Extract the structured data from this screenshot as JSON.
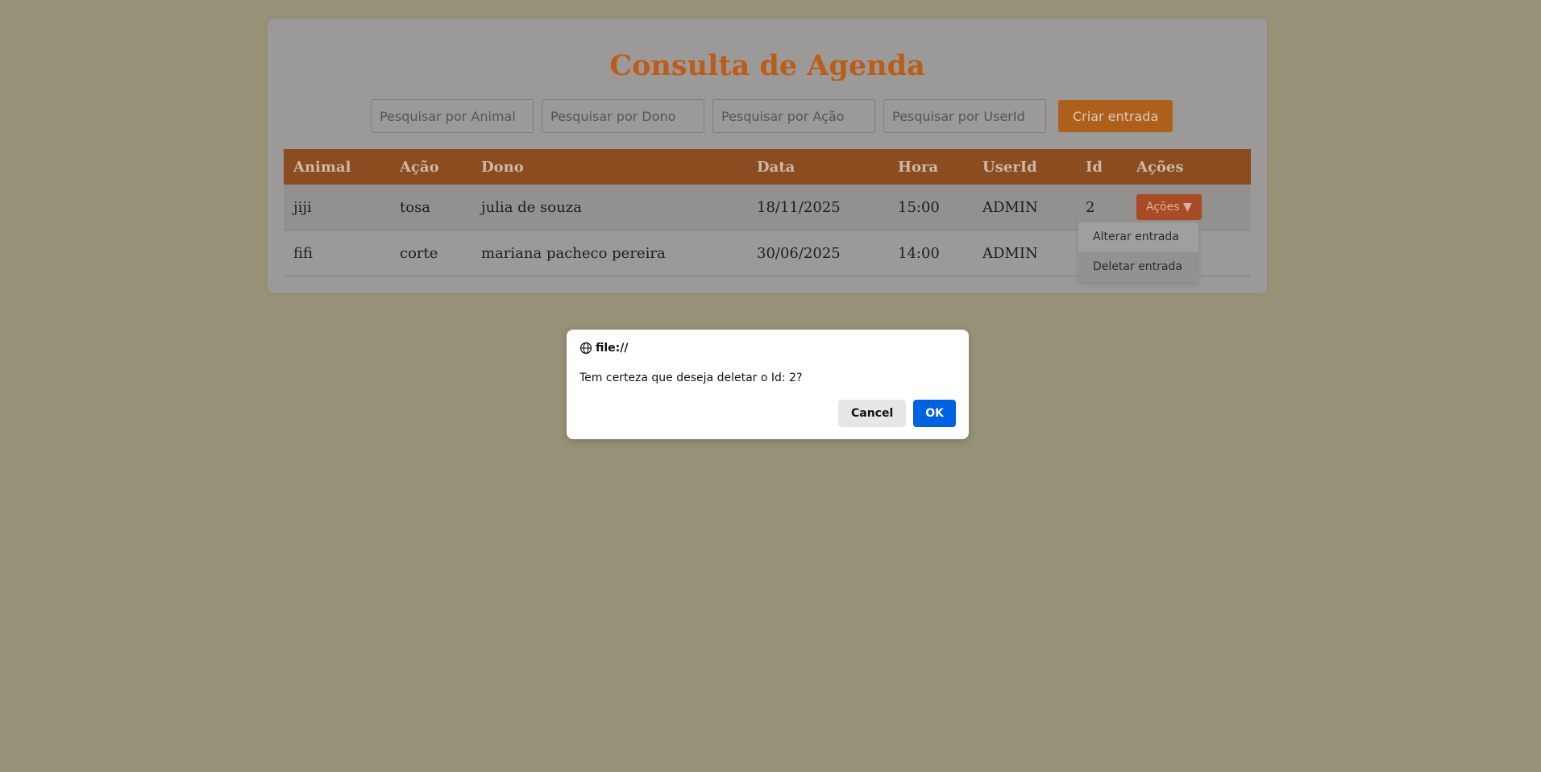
{
  "page": {
    "title": "Consulta de Agenda"
  },
  "search": {
    "animal_placeholder": "Pesquisar por Animal",
    "dono_placeholder": "Pesquisar por Dono",
    "acao_placeholder": "Pesquisar por Ação",
    "userid_placeholder": "Pesquisar por UserId",
    "create_label": "Criar entrada"
  },
  "table": {
    "headers": [
      "Animal",
      "Ação",
      "Dono",
      "Data",
      "Hora",
      "UserId",
      "Id",
      "Ações"
    ],
    "rows": [
      {
        "animal": "jiji",
        "acao": "tosa",
        "dono": "julia de souza",
        "data": "18/11/2025",
        "hora": "15:00",
        "userid": "ADMIN",
        "id": "2",
        "actions_label": "Ações ▼"
      },
      {
        "animal": "fifi",
        "acao": "corte",
        "dono": "mariana pacheco pereira",
        "data": "30/06/2025",
        "hora": "14:00",
        "userid": "ADMIN",
        "id": "",
        "actions_label": ""
      }
    ]
  },
  "dropdown": {
    "items": [
      "Alterar entrada",
      "Deletar entrada"
    ],
    "hovered_index": 1
  },
  "dialog": {
    "origin": "file://",
    "message": "Tem certeza que deseja deletar o Id: 2?",
    "cancel_label": "Cancel",
    "ok_label": "OK"
  },
  "colors": {
    "background": "#979277",
    "title": "#bb5d17",
    "header_bar": "#8b4c1f",
    "create_button": "#ad5f1c",
    "actions_button": "#a94b24",
    "ok_button": "#0062e1"
  },
  "icons": {
    "dialog_origin": "globe-icon"
  }
}
